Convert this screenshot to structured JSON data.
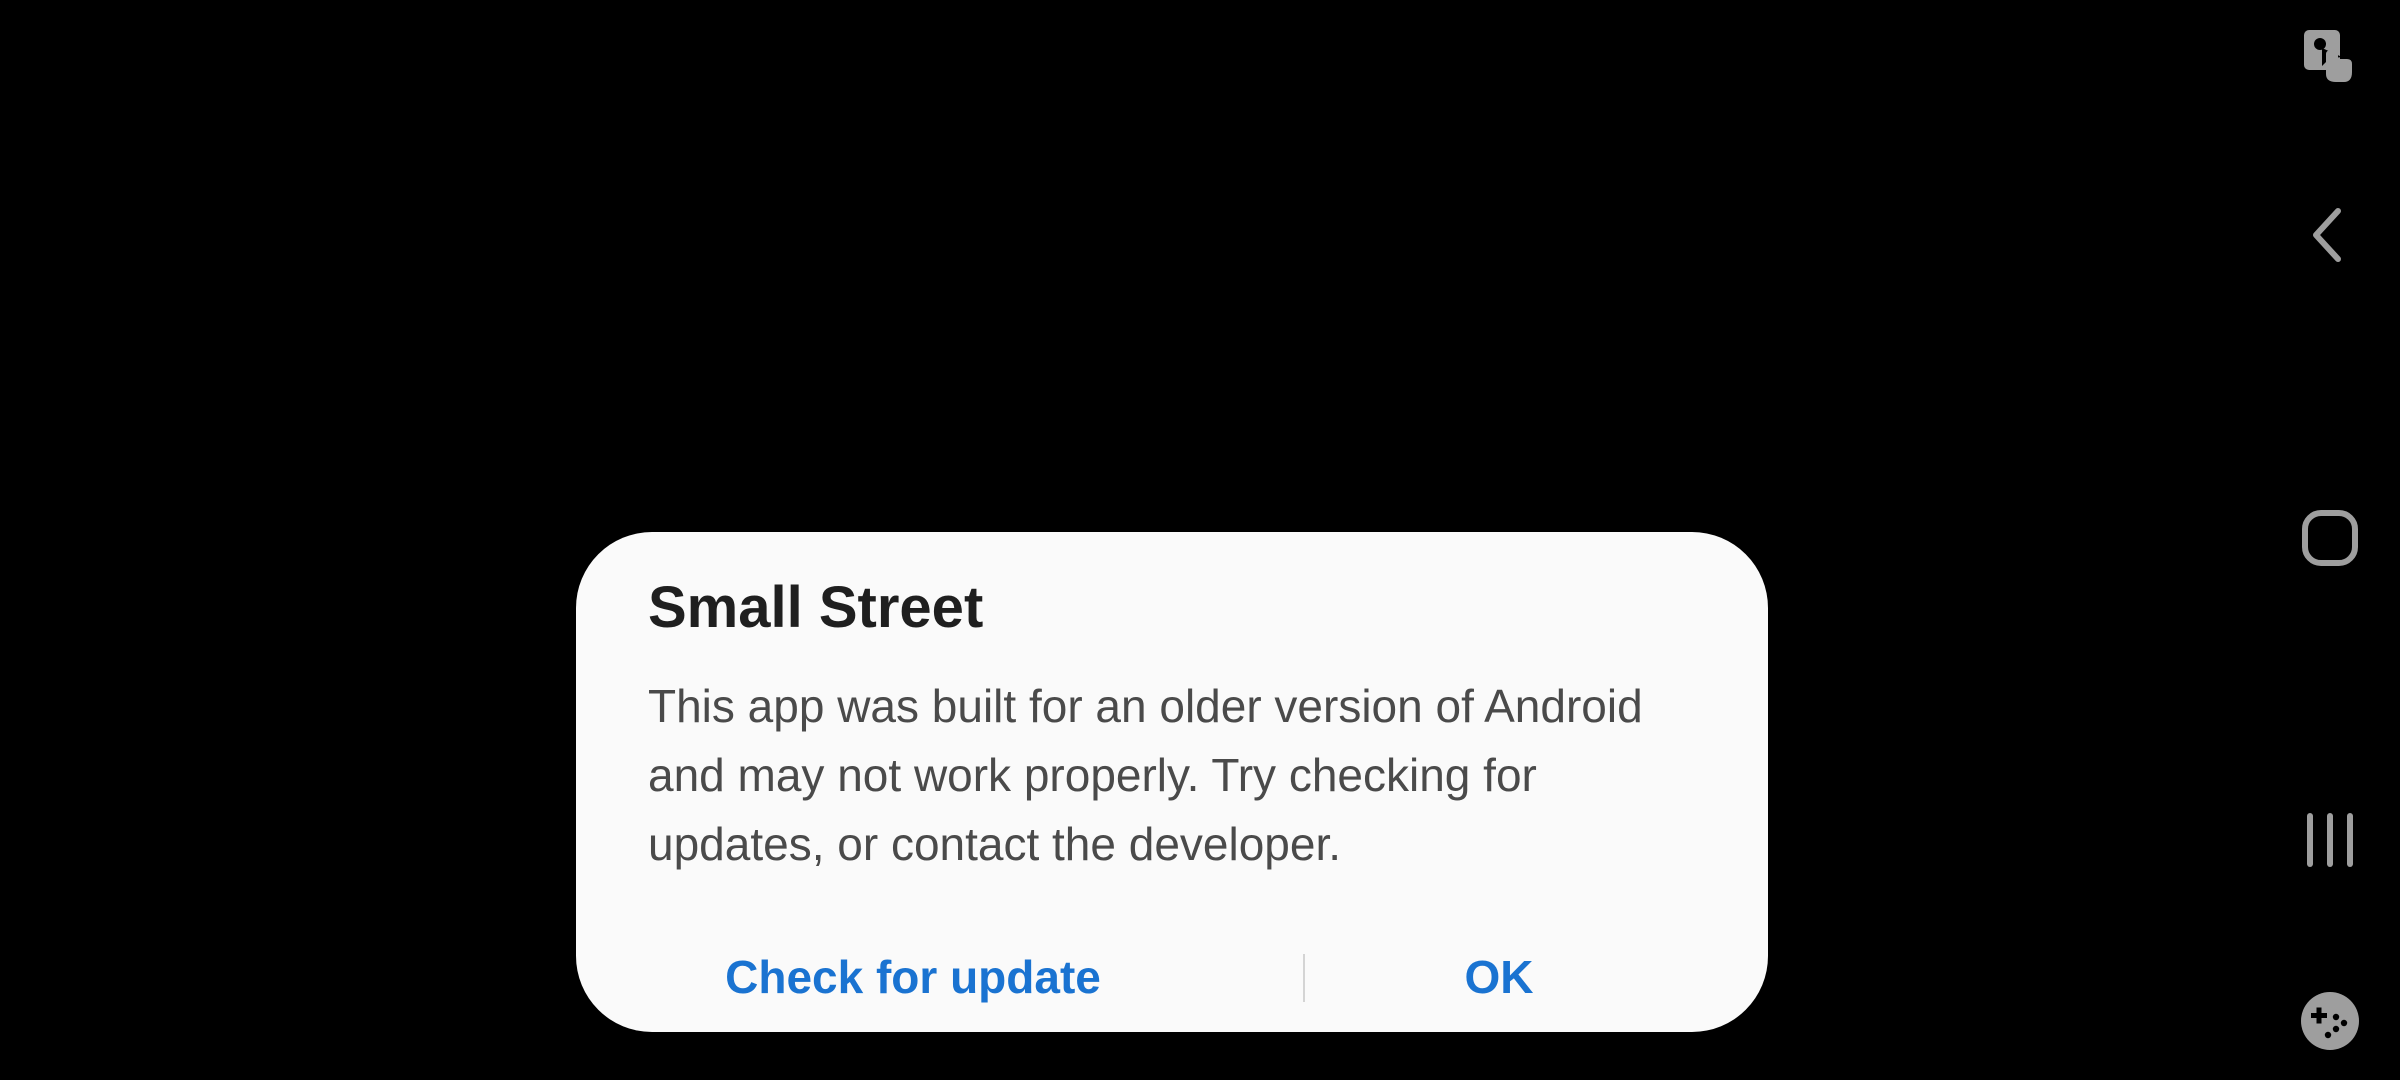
{
  "dialog": {
    "title": "Small Street",
    "message": "This app was built for an older version of Android and may not work properly. Try checking for updates, or contact the developer.",
    "buttons": {
      "check_for_update": "Check for update",
      "ok": "OK"
    },
    "accent_color": "#1a73d1",
    "background_color": "#fafafa"
  },
  "navbar": {
    "icons": [
      "screen-touch-icon",
      "back-icon",
      "home-icon",
      "recents-icon",
      "game-tools-icon"
    ],
    "icon_color": "#9e9e9e"
  },
  "background_color": "#000000"
}
